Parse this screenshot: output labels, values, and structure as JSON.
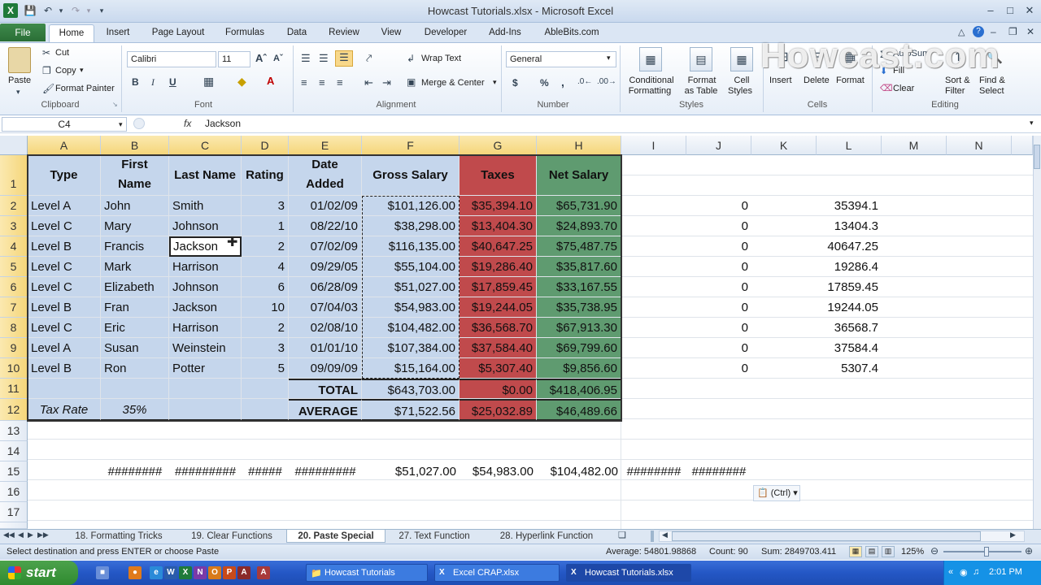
{
  "window": {
    "title": "Howcast Tutorials.xlsx - Microsoft Excel"
  },
  "tabs": [
    "File",
    "Home",
    "Insert",
    "Page Layout",
    "Formulas",
    "Data",
    "Review",
    "View",
    "Developer",
    "Add-Ins",
    "AbleBits.com"
  ],
  "ribbon": {
    "clipboard": {
      "label": "Clipboard",
      "paste": "Paste",
      "cut": "Cut",
      "copy": "Copy",
      "format_painter": "Format Painter"
    },
    "font": {
      "label": "Font",
      "name": "Calibri",
      "size": "11"
    },
    "alignment": {
      "label": "Alignment",
      "wrap": "Wrap Text",
      "merge": "Merge & Center"
    },
    "number": {
      "label": "Number",
      "format": "General",
      "symbols": [
        "$",
        "%",
        ","
      ]
    },
    "styles": {
      "label": "Styles",
      "conditional": [
        "Conditional",
        "Formatting"
      ],
      "format_table": [
        "Format",
        "as Table"
      ],
      "cell_styles": [
        "Cell",
        "Styles"
      ]
    },
    "cells": {
      "label": "Cells",
      "insert": "Insert",
      "delete": "Delete",
      "format": "Format"
    },
    "editing": {
      "label": "Editing",
      "autosum": "AutoSum",
      "fill": "Fill",
      "clear": "Clear",
      "sort": [
        "Sort &",
        "Filter"
      ],
      "find": [
        "Find &",
        "Select"
      ]
    }
  },
  "watermark": "Howcast.com",
  "formula_bar": {
    "name_box": "C4",
    "fx": "fx",
    "content": "Jackson"
  },
  "columns": [
    "A",
    "B",
    "C",
    "D",
    "E",
    "F",
    "G",
    "H",
    "I",
    "J",
    "K",
    "L",
    "M",
    "N"
  ],
  "rows": [
    "1",
    "2",
    "3",
    "4",
    "5",
    "6",
    "7",
    "8",
    "9",
    "10",
    "11",
    "12",
    "13",
    "14",
    "15",
    "16",
    "17"
  ],
  "header_row": {
    "A": "Type",
    "B": [
      "First",
      "Name"
    ],
    "C": "Last Name",
    "D": "Rating",
    "E": [
      "Date",
      "Added"
    ],
    "F": "Gross Salary",
    "G": "Taxes",
    "H": "Net Salary"
  },
  "data_rows": [
    {
      "A": "Level A",
      "B": "John",
      "C": "Smith",
      "D": "3",
      "E": "01/02/09",
      "F": "$101,126.00",
      "G": "$35,394.10",
      "H": "$65,731.90",
      "J": "0",
      "L": "35394.1"
    },
    {
      "A": "Level C",
      "B": "Mary",
      "C": "Johnson",
      "D": "1",
      "E": "08/22/10",
      "F": "$38,298.00",
      "G": "$13,404.30",
      "H": "$24,893.70",
      "J": "0",
      "L": "13404.3"
    },
    {
      "A": "Level B",
      "B": "Francis",
      "C": "Jackson",
      "D": "2",
      "E": "07/02/09",
      "F": "$116,135.00",
      "G": "$40,647.25",
      "H": "$75,487.75",
      "J": "0",
      "L": "40647.25"
    },
    {
      "A": "Level C",
      "B": "Mark",
      "C": "Harrison",
      "D": "4",
      "E": "09/29/05",
      "F": "$55,104.00",
      "G": "$19,286.40",
      "H": "$35,817.60",
      "J": "0",
      "L": "19286.4"
    },
    {
      "A": "Level C",
      "B": "Elizabeth",
      "C": "Johnson",
      "D": "6",
      "E": "06/28/09",
      "F": "$51,027.00",
      "G": "$17,859.45",
      "H": "$33,167.55",
      "J": "0",
      "L": "17859.45"
    },
    {
      "A": "Level B",
      "B": "Fran",
      "C": "Jackson",
      "D": "10",
      "E": "07/04/03",
      "F": "$54,983.00",
      "G": "$19,244.05",
      "H": "$35,738.95",
      "J": "0",
      "L": "19244.05"
    },
    {
      "A": "Level C",
      "B": "Eric",
      "C": "Harrison",
      "D": "2",
      "E": "02/08/10",
      "F": "$104,482.00",
      "G": "$36,568.70",
      "H": "$67,913.30",
      "J": "0",
      "L": "36568.7"
    },
    {
      "A": "Level A",
      "B": "Susan",
      "C": "Weinstein",
      "D": "3",
      "E": "01/01/10",
      "F": "$107,384.00",
      "G": "$37,584.40",
      "H": "$69,799.60",
      "J": "0",
      "L": "37584.4"
    },
    {
      "A": "Level B",
      "B": "Ron",
      "C": "Potter",
      "D": "5",
      "E": "09/09/09",
      "F": "$15,164.00",
      "G": "$5,307.40",
      "H": "$9,856.60",
      "J": "0",
      "L": "5307.4"
    }
  ],
  "total_row": {
    "E": "TOTAL",
    "F": "$643,703.00",
    "G": "$0.00",
    "H": "$418,406.95"
  },
  "average_row": {
    "A": "Tax Rate",
    "B": "35%",
    "E": "AVERAGE",
    "F": "$71,522.56",
    "G": "$25,032.89",
    "H": "$46,489.66"
  },
  "row15": {
    "B": "########",
    "C": "#########",
    "D": "#####",
    "E": "#########",
    "F": "$51,027.00",
    "G": "$54,983.00",
    "H": "$104,482.00",
    "I": "########",
    "J": "########"
  },
  "paste_options": "(Ctrl)",
  "sheet_tabs": [
    "18. Formatting Tricks",
    "19. Clear Functions",
    "20. Paste Special",
    "27. Text Function",
    "28. Hyperlink Function"
  ],
  "status": {
    "message": "Select destination and press ENTER or choose Paste",
    "average": "Average: 54801.98868",
    "count": "Count: 90",
    "sum": "Sum: 2849703.411",
    "zoom": "125%"
  },
  "taskbar": {
    "start": "start",
    "items": [
      "Howcast Tutorials",
      "Excel CRAP.xlsx",
      "Howcast Tutorials.xlsx"
    ],
    "time": "2:01 PM"
  }
}
